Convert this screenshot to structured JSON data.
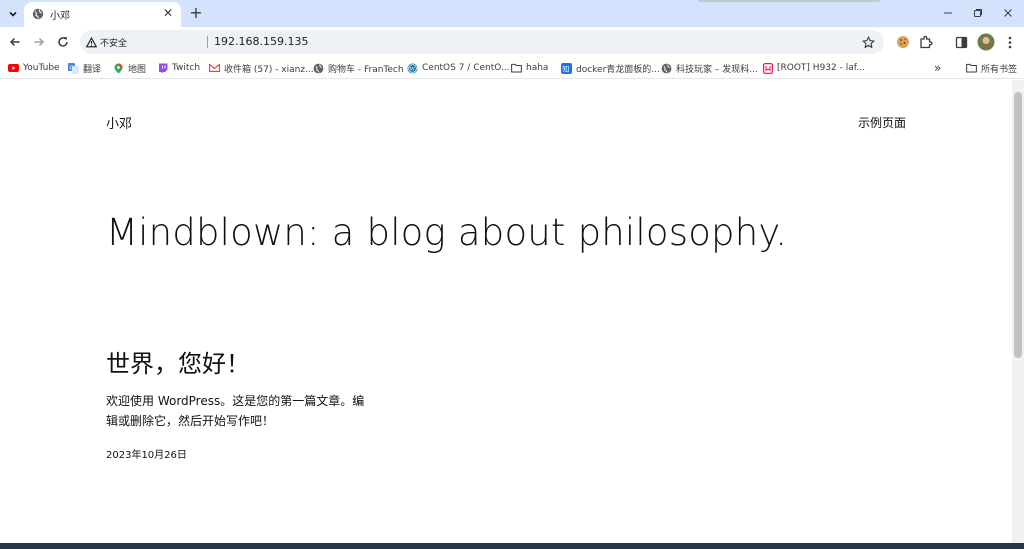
{
  "browser": {
    "tab": {
      "title": "小邓",
      "favicon": "globe-icon"
    },
    "address": {
      "security_label": "不安全",
      "url": "192.168.159.135"
    },
    "colors": {
      "tabstrip": "#d3e3fd",
      "omnibox": "#eef1f6"
    }
  },
  "bookmarks": [
    {
      "label": "YouTube",
      "icon": "youtube-icon",
      "color": "#ff0000"
    },
    {
      "label": "翻译",
      "icon": "translate-icon",
      "color": "#4285f4"
    },
    {
      "label": "地图",
      "icon": "maps-icon",
      "color": "#34a853"
    },
    {
      "label": "Twitch",
      "icon": "twitch-icon",
      "color": "#9146ff"
    },
    {
      "label": "收件箱 (57) - xianz...",
      "icon": "gmail-icon",
      "color": "#ea4335"
    },
    {
      "label": "购物车 - FranTech",
      "icon": "globe-icon",
      "color": "#5f6368"
    },
    {
      "label": "CentOS 7 / CentO...",
      "icon": "wordpress-icon",
      "color": "#21759b"
    },
    {
      "label": "haha",
      "icon": "folder-icon",
      "color": "#5f6368"
    },
    {
      "label": "docker青龙面板的...",
      "icon": "zhihu-icon",
      "color": "#1772f6"
    },
    {
      "label": "科技玩家 – 发现科...",
      "icon": "globe-icon",
      "color": "#5f6368"
    },
    {
      "label": "[ROOT] H932 - laf...",
      "icon": "bookmark-icon",
      "color": "#e91e63"
    }
  ],
  "bookmarks_overflow": "»",
  "all_bookmarks_label": "所有书签",
  "page": {
    "site_title": "小邓",
    "nav_link": "示例页面",
    "headline": "Mindblown: a blog about philosophy.",
    "post": {
      "title": "世界，您好！",
      "excerpt": "欢迎使用 WordPress。这是您的第一篇文章。编辑或删除它，然后开始写作吧！",
      "date": "2023年10月26日"
    }
  }
}
